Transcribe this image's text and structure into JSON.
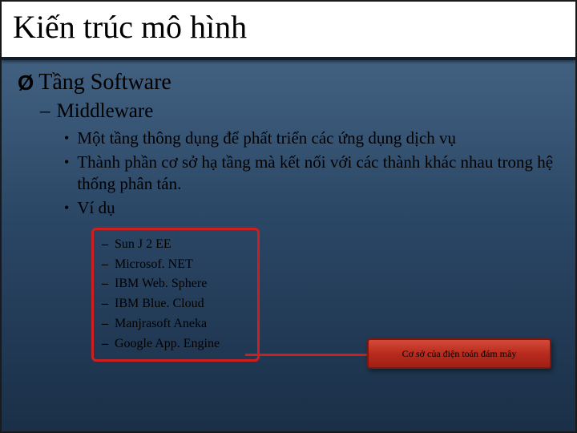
{
  "title": "Kiến trúc mô hình",
  "l1": {
    "chevron": "Ø",
    "text": "Tầng Software"
  },
  "l2": {
    "dash": "–",
    "text": "Middleware"
  },
  "bullets": {
    "dot": "•",
    "b1": "Một tầng thông dụng để phất triển các ứng dụng dịch vụ",
    "b2": "Thành phần cơ sở hạ tầng mà kết nối với các thành khác nhau trong hệ thống phân tán.",
    "b3": "Ví dụ"
  },
  "subdash": "–",
  "sub": {
    "s1": "Sun J 2 EE",
    "s2": "Microsof. NET",
    "s3": "IBM Web. Sphere",
    "s4": "IBM Blue. Cloud",
    "s5": "Manjrasoft Aneka",
    "s6": "Google App. Engine"
  },
  "callout": "Cơ sở của điện toán đám mây"
}
